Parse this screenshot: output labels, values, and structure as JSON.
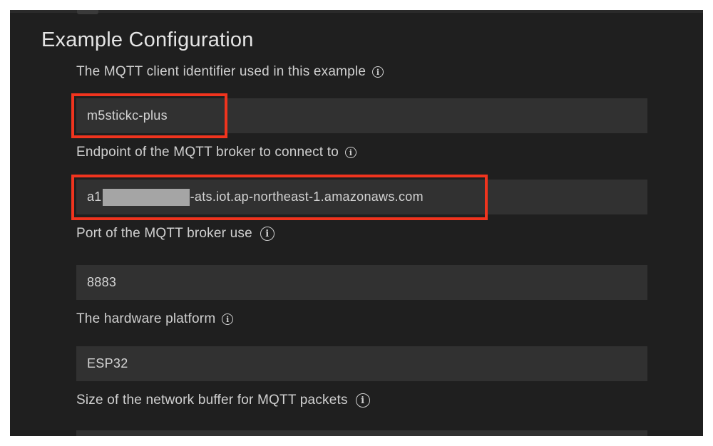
{
  "section": {
    "title": "Example Configuration"
  },
  "settings": [
    {
      "label": "The MQTT client identifier used in this example",
      "value": "m5stickc-plus"
    },
    {
      "label": "Endpoint of the MQTT broker to connect to",
      "value_prefix": "a1",
      "value_suffix": "-ats.iot.ap-northeast-1.amazonaws.com"
    },
    {
      "label": "Port of the MQTT broker use",
      "value": "8883"
    },
    {
      "label": "The hardware platform",
      "value": "ESP32"
    },
    {
      "label": "Size of the network buffer for MQTT packets",
      "value": ""
    }
  ],
  "icons": {
    "info": "info-icon"
  },
  "colors": {
    "background": "#1f1f1f",
    "field": "#313131",
    "highlight": "#f0341e",
    "text": "#d0d0d0"
  }
}
